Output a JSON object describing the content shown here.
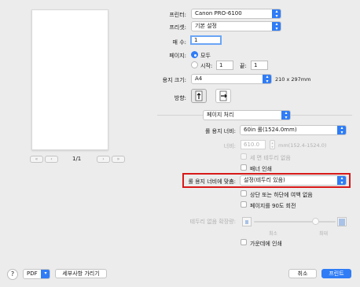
{
  "preview": {
    "page_indicator": "1/1",
    "first_btn": "«",
    "prev_btn": "‹",
    "next_btn": "›",
    "last_btn": "»"
  },
  "printer": {
    "label": "프린터:",
    "value": "Canon PRO-6100"
  },
  "preset": {
    "label": "프리셋:",
    "value": "기본 설정"
  },
  "copies": {
    "label": "매 수:",
    "value": "1"
  },
  "pages": {
    "label": "페이지:",
    "all": "모두",
    "from": "시작:",
    "from_value": "1",
    "to": "끝:",
    "to_value": "1"
  },
  "paper_size": {
    "label": "용지 크기:",
    "value": "A4",
    "dims": "210 x 297mm"
  },
  "orientation": {
    "label": "방향:"
  },
  "panel": {
    "value": "페이지 처리"
  },
  "roll_width": {
    "label": "롤 용지 너비:",
    "value": "60in 롤(1524.0mm)"
  },
  "width": {
    "label": "너비:",
    "value": "610.0",
    "range": "mm(152.4-1524.0)"
  },
  "options": {
    "borderless_vertical": "세 면 테두리 없음",
    "banner": "배너 인쇄",
    "no_margin": "상단 또는 하단에 여백 없음",
    "rotate": "페이지를 90도 회전",
    "center": "가운데에 인쇄"
  },
  "fit_roll": {
    "label": "롤 용지 너비에 맞춤:",
    "value": "설정(테두리 있음)"
  },
  "extension": {
    "label": "테두리 없음 확장량:",
    "min": "최소",
    "max": "최대",
    "level": 0.75
  },
  "footer": {
    "help": "?",
    "pdf": "PDF",
    "details": "세부사항 가리기",
    "cancel": "취소",
    "print": "프린트"
  },
  "colors": {
    "accent": "#2f7cf6",
    "highlight": "#d81818"
  }
}
